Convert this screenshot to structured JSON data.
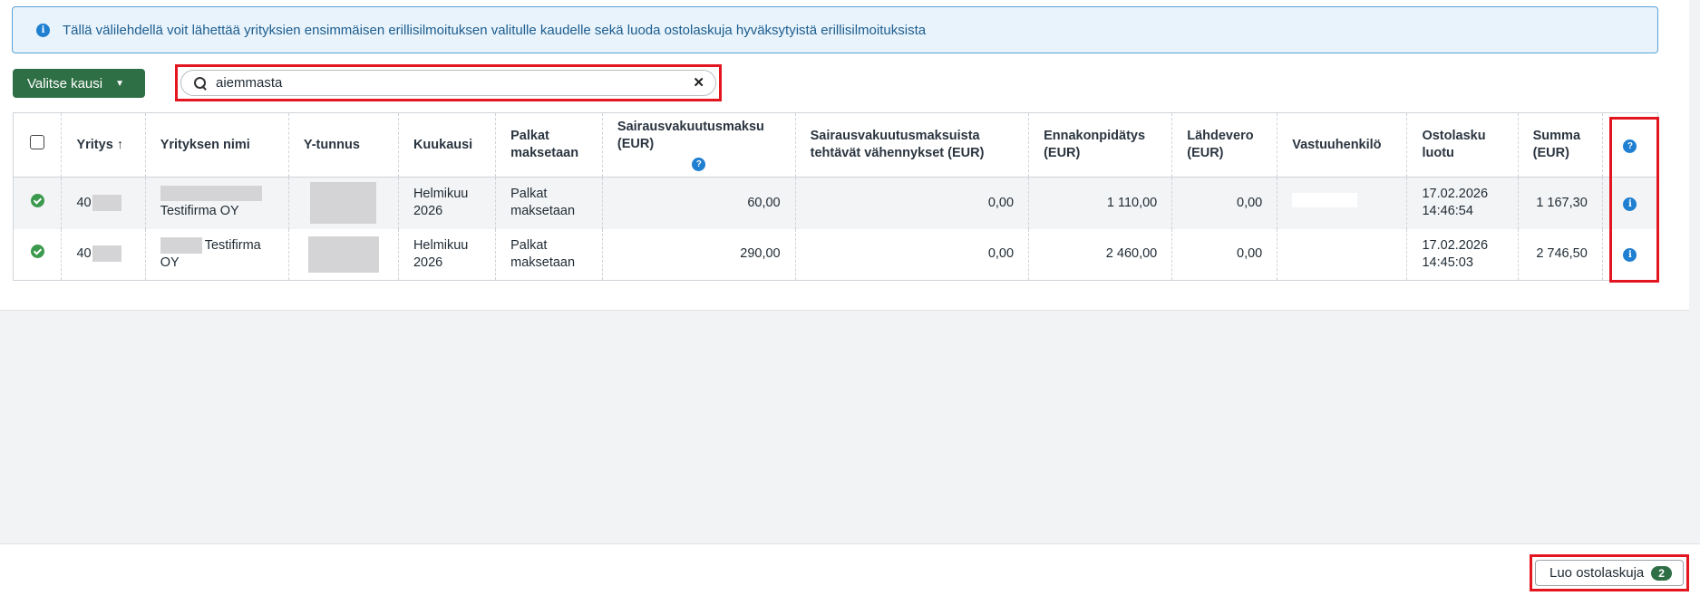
{
  "banner": {
    "text": "Tällä välilehdellä voit lähettää yrityksien ensimmäisen erillisilmoituksen valitulle kaudelle sekä luoda ostolaskuja hyväksytyistä erillisilmoituksista"
  },
  "toolbar": {
    "period_label": "Valitse kausi"
  },
  "search": {
    "value": "aiemmasta"
  },
  "table": {
    "headers": {
      "company": "Yritys",
      "company_name": "Yrityksen nimi",
      "business_id": "Y-tunnus",
      "month": "Kuukausi",
      "salaries_paid": "Palkat maksetaan",
      "sickness_fee": "Sairausvakuutusmaksu (EUR)",
      "sickness_deductions": "Sairausvakuutusmaksuista tehtävät vähennykset (EUR)",
      "withholding": "Ennakonpidätys (EUR)",
      "source_tax": "Lähdevero (EUR)",
      "responsible": "Vastuuhenkilö",
      "invoice_created": "Ostolasku luotu",
      "total": "Summa (EUR)"
    },
    "rows": [
      {
        "company": "40",
        "company_name": "Testifirma OY",
        "month": "Helmikuu 2026",
        "salaries_paid": "Palkat maksetaan",
        "sickness_fee": "60,00",
        "sickness_deductions": "0,00",
        "withholding": "1 110,00",
        "source_tax": "0,00",
        "invoice_created": "17.02.2026 14:46:54",
        "total": "1 167,30"
      },
      {
        "company": "40",
        "company_name": "Testifirma OY",
        "month": "Helmikuu 2026",
        "salaries_paid": "Palkat maksetaan",
        "sickness_fee": "290,00",
        "sickness_deductions": "0,00",
        "withholding": "2 460,00",
        "source_tax": "0,00",
        "invoice_created": "17.02.2026 14:45:03",
        "total": "2 746,50"
      }
    ]
  },
  "footer": {
    "create_label": "Luo ostolaskuja",
    "count": "2"
  },
  "colors": {
    "primary_green": "#2f6f46",
    "info_blue": "#1f7fd1",
    "highlight_red": "#e3151f"
  },
  "icons": {
    "banner": "info-icon",
    "search": "search-icon",
    "clear": "close-icon",
    "status": "check-circle-icon",
    "row_action": "info-icon",
    "header_help": "help-icon"
  }
}
